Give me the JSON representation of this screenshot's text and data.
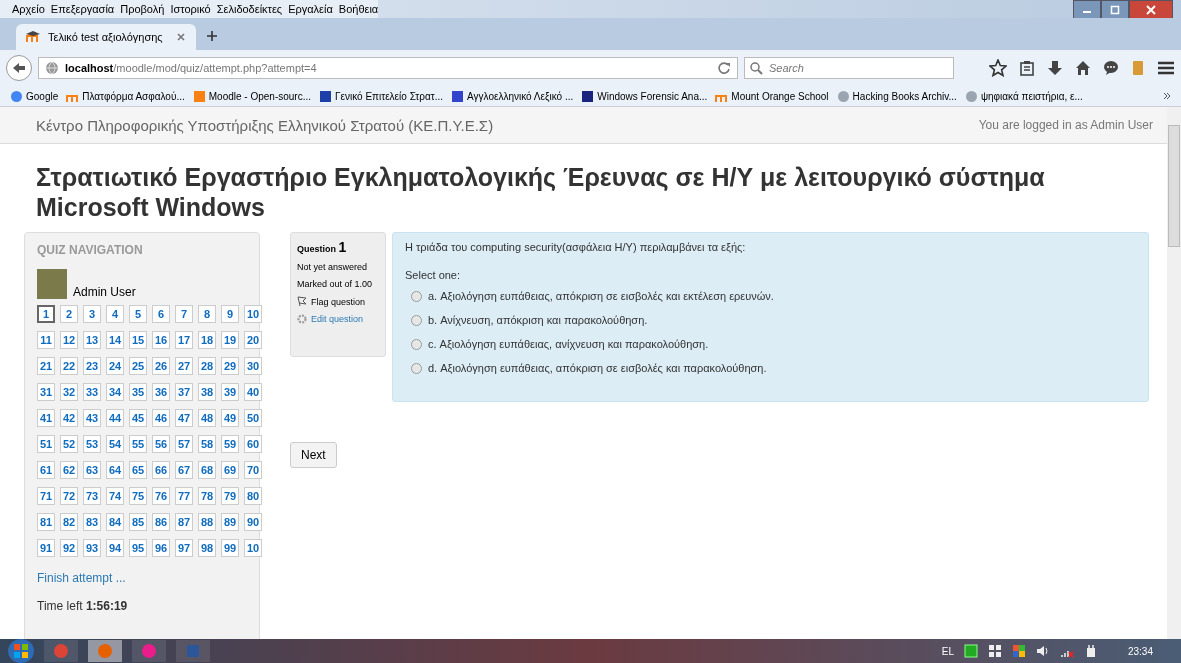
{
  "menu_bar": [
    "Αρχείο",
    "Επεξεργασία",
    "Προβολή",
    "Ιστορικό",
    "Σελιδοδείκτες",
    "Εργαλεία",
    "Βοήθεια"
  ],
  "tab": {
    "title": "Τελικό test αξιολόγησης",
    "selected": true
  },
  "address_bar": {
    "host": "localhost",
    "path": "/moodle/mod/quiz/attempt.php?attempt=4"
  },
  "search": {
    "placeholder": "Search"
  },
  "bookmarks": [
    {
      "kind": "google",
      "label": "Google"
    },
    {
      "kind": "moodle",
      "label": "Πλατφόρμα Ασφαλού..."
    },
    {
      "kind": "moodle-box",
      "label": "Moodle - Open-sourc..."
    },
    {
      "kind": "flag",
      "label": "Γενικό Επιτελείο Στρατ..."
    },
    {
      "kind": "wr",
      "label": "Αγγλοελληνικό Λεξικό ..."
    },
    {
      "kind": "sans",
      "label": "Windows Forensic Ana..."
    },
    {
      "kind": "moodle",
      "label": "Mount Orange School"
    },
    {
      "kind": "globe",
      "label": "Hacking Books Archiv..."
    },
    {
      "kind": "globe",
      "label": "ψηφιακά πειστήρια, ε..."
    }
  ],
  "site_header": {
    "title": "Κέντρο Πληροφορικής Υποστήριξης Ελληνικού Στρατού (ΚΕ.Π.Υ.Ε.Σ)",
    "login": "You are logged in as Admin User"
  },
  "page_title": "Στρατιωτικό Εργαστήριο Εγκληματολογικής Έρευνας σε Η/Υ με λειτουργικό σύστημα Microsoft Windows",
  "quiz_navigation": {
    "heading": "QUIZ NAVIGATION",
    "user": "Admin User",
    "buttons": [
      {
        "label": "1",
        "selected": true
      },
      {
        "label": "2",
        "selected": false
      },
      {
        "label": "3",
        "selected": false
      },
      {
        "label": "4",
        "selected": false
      },
      {
        "label": "5",
        "selected": false
      },
      {
        "label": "6",
        "selected": false
      },
      {
        "label": "7",
        "selected": false
      },
      {
        "label": "8",
        "selected": false
      },
      {
        "label": "9",
        "selected": false
      },
      {
        "label": "10",
        "selected": false
      },
      {
        "label": "11",
        "selected": false
      },
      {
        "label": "12",
        "selected": false
      },
      {
        "label": "13",
        "selected": false
      },
      {
        "label": "14",
        "selected": false
      },
      {
        "label": "15",
        "selected": false
      },
      {
        "label": "16",
        "selected": false
      },
      {
        "label": "17",
        "selected": false
      },
      {
        "label": "18",
        "selected": false
      },
      {
        "label": "19",
        "selected": false
      },
      {
        "label": "20",
        "selected": false
      },
      {
        "label": "21",
        "selected": false
      },
      {
        "label": "22",
        "selected": false
      },
      {
        "label": "23",
        "selected": false
      },
      {
        "label": "24",
        "selected": false
      },
      {
        "label": "25",
        "selected": false
      },
      {
        "label": "26",
        "selected": false
      },
      {
        "label": "27",
        "selected": false
      },
      {
        "label": "28",
        "selected": false
      },
      {
        "label": "29",
        "selected": false
      },
      {
        "label": "30",
        "selected": false
      },
      {
        "label": "31",
        "selected": false
      },
      {
        "label": "32",
        "selected": false
      },
      {
        "label": "33",
        "selected": false
      },
      {
        "label": "34",
        "selected": false
      },
      {
        "label": "35",
        "selected": false
      },
      {
        "label": "36",
        "selected": false
      },
      {
        "label": "37",
        "selected": false
      },
      {
        "label": "38",
        "selected": false
      },
      {
        "label": "39",
        "selected": false
      },
      {
        "label": "40",
        "selected": false
      },
      {
        "label": "41",
        "selected": false
      },
      {
        "label": "42",
        "selected": false
      },
      {
        "label": "43",
        "selected": false
      },
      {
        "label": "44",
        "selected": false
      },
      {
        "label": "45",
        "selected": false
      },
      {
        "label": "46",
        "selected": false
      },
      {
        "label": "47",
        "selected": false
      },
      {
        "label": "48",
        "selected": false
      },
      {
        "label": "49",
        "selected": false
      },
      {
        "label": "50",
        "selected": false
      },
      {
        "label": "51",
        "selected": false
      },
      {
        "label": "52",
        "selected": false
      },
      {
        "label": "53",
        "selected": false
      },
      {
        "label": "54",
        "selected": false
      },
      {
        "label": "55",
        "selected": false
      },
      {
        "label": "56",
        "selected": false
      },
      {
        "label": "57",
        "selected": false
      },
      {
        "label": "58",
        "selected": false
      },
      {
        "label": "59",
        "selected": false
      },
      {
        "label": "60",
        "selected": false
      },
      {
        "label": "61",
        "selected": false
      },
      {
        "label": "62",
        "selected": false
      },
      {
        "label": "63",
        "selected": false
      },
      {
        "label": "64",
        "selected": false
      },
      {
        "label": "65",
        "selected": false
      },
      {
        "label": "66",
        "selected": false
      },
      {
        "label": "67",
        "selected": false
      },
      {
        "label": "68",
        "selected": false
      },
      {
        "label": "69",
        "selected": false
      },
      {
        "label": "70",
        "selected": false
      },
      {
        "label": "71",
        "selected": false
      },
      {
        "label": "72",
        "selected": false
      },
      {
        "label": "73",
        "selected": false
      },
      {
        "label": "74",
        "selected": false
      },
      {
        "label": "75",
        "selected": false
      },
      {
        "label": "76",
        "selected": false
      },
      {
        "label": "77",
        "selected": false
      },
      {
        "label": "78",
        "selected": false
      },
      {
        "label": "79",
        "selected": false
      },
      {
        "label": "80",
        "selected": false
      },
      {
        "label": "81",
        "selected": false
      },
      {
        "label": "82",
        "selected": false
      },
      {
        "label": "83",
        "selected": false
      },
      {
        "label": "84",
        "selected": false
      },
      {
        "label": "85",
        "selected": false
      },
      {
        "label": "86",
        "selected": false
      },
      {
        "label": "87",
        "selected": false
      },
      {
        "label": "88",
        "selected": false
      },
      {
        "label": "89",
        "selected": false
      },
      {
        "label": "90",
        "selected": false
      },
      {
        "label": "91",
        "selected": false
      },
      {
        "label": "92",
        "selected": false
      },
      {
        "label": "93",
        "selected": false
      },
      {
        "label": "94",
        "selected": false
      },
      {
        "label": "95",
        "selected": false
      },
      {
        "label": "96",
        "selected": false
      },
      {
        "label": "97",
        "selected": false
      },
      {
        "label": "98",
        "selected": false
      },
      {
        "label": "99",
        "selected": false
      },
      {
        "label": "10",
        "selected": false
      }
    ],
    "finish_link": "Finish attempt ...",
    "time_left_label": "Time left",
    "time_left": "1:56:19"
  },
  "question_info": {
    "label": "Question",
    "number": "1",
    "status": "Not yet answered",
    "marks": "Marked out of 1.00",
    "flag": "Flag question",
    "edit": "Edit question"
  },
  "question": {
    "text": "Η τριάδα του computing security(ασφάλεια Η/Υ) περιλαμβάνει τα εξής:",
    "prompt": "Select one:",
    "options": [
      {
        "label": "a. Αξιολόγηση ευπάθειας, απόκριση σε εισβολές και εκτέλεση ερευνών.",
        "selected": false
      },
      {
        "label": "b. Ανίχνευση, απόκριση και παρακολούθηση.",
        "selected": false
      },
      {
        "label": "c. Αξιολόγηση ευπάθειας, ανίχνευση και παρακολούθηση.",
        "selected": false
      },
      {
        "label": "d. Αξιολόγηση ευπάθειας, απόκριση σε εισβολές και παρακολούθηση.",
        "selected": false
      }
    ]
  },
  "next_button": "Next",
  "taskbar": {
    "apps": [
      {
        "kind": "chrome",
        "selected": false
      },
      {
        "kind": "firefox",
        "selected": true
      },
      {
        "kind": "wamp",
        "selected": false
      },
      {
        "kind": "word",
        "selected": false
      }
    ],
    "language": "EL",
    "clock": "23:34"
  }
}
